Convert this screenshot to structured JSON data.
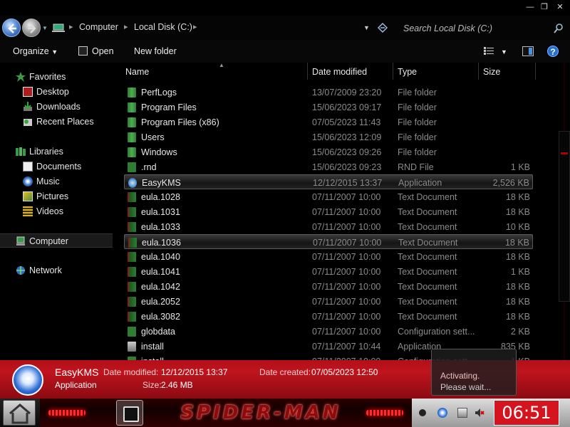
{
  "address": {
    "crumbs": [
      "Computer",
      "Local Disk (C:)"
    ],
    "search_placeholder": "Search Local Disk (C:)"
  },
  "toolbar": {
    "organize": "Organize",
    "open": "Open",
    "new_folder": "New folder"
  },
  "nav": {
    "favorites": "Favorites",
    "desktop": "Desktop",
    "downloads": "Downloads",
    "recent": "Recent Places",
    "libraries": "Libraries",
    "documents": "Documents",
    "music": "Music",
    "pictures": "Pictures",
    "videos": "Videos",
    "computer": "Computer",
    "network": "Network"
  },
  "columns": {
    "name": "Name",
    "date": "Date modified",
    "type": "Type",
    "size": "Size"
  },
  "files": [
    {
      "name": "PerfLogs",
      "date": "13/07/2009 23:20",
      "type": "File folder",
      "size": "",
      "icon": "folder"
    },
    {
      "name": "Program Files",
      "date": "15/06/2023 09:17",
      "type": "File folder",
      "size": "",
      "icon": "folder"
    },
    {
      "name": "Program Files (x86)",
      "date": "07/05/2023 11:43",
      "type": "File folder",
      "size": "",
      "icon": "folder"
    },
    {
      "name": "Users",
      "date": "15/06/2023 12:09",
      "type": "File folder",
      "size": "",
      "icon": "folder"
    },
    {
      "name": "Windows",
      "date": "15/06/2023 09:26",
      "type": "File folder",
      "size": "",
      "icon": "folder"
    },
    {
      "name": ".rnd",
      "date": "15/06/2023 09:23",
      "type": "RND File",
      "size": "1 KB",
      "icon": "rnd"
    },
    {
      "name": "EasyKMS",
      "date": "12/12/2015 13:37",
      "type": "Application",
      "size": "2,526 KB",
      "icon": "app"
    },
    {
      "name": "eula.1028",
      "date": "07/11/2007 10:00",
      "type": "Text Document",
      "size": "18 KB",
      "icon": "doc"
    },
    {
      "name": "eula.1031",
      "date": "07/11/2007 10:00",
      "type": "Text Document",
      "size": "18 KB",
      "icon": "doc"
    },
    {
      "name": "eula.1033",
      "date": "07/11/2007 10:00",
      "type": "Text Document",
      "size": "10 KB",
      "icon": "doc"
    },
    {
      "name": "eula.1036",
      "date": "07/11/2007 10:00",
      "type": "Text Document",
      "size": "18 KB",
      "icon": "doc"
    },
    {
      "name": "eula.1040",
      "date": "07/11/2007 10:00",
      "type": "Text Document",
      "size": "18 KB",
      "icon": "doc"
    },
    {
      "name": "eula.1041",
      "date": "07/11/2007 10:00",
      "type": "Text Document",
      "size": "1 KB",
      "icon": "doc"
    },
    {
      "name": "eula.1042",
      "date": "07/11/2007 10:00",
      "type": "Text Document",
      "size": "18 KB",
      "icon": "doc"
    },
    {
      "name": "eula.2052",
      "date": "07/11/2007 10:00",
      "type": "Text Document",
      "size": "18 KB",
      "icon": "doc"
    },
    {
      "name": "eula.3082",
      "date": "07/11/2007 10:00",
      "type": "Text Document",
      "size": "18 KB",
      "icon": "doc"
    },
    {
      "name": "globdata",
      "date": "07/11/2007 10:00",
      "type": "Configuration sett...",
      "size": "2 KB",
      "icon": "cfg"
    },
    {
      "name": "install",
      "date": "07/11/2007 10:44",
      "type": "Application",
      "size": "835 KB",
      "icon": "inst"
    },
    {
      "name": "install",
      "date": "07/11/2007 10:00",
      "type": "Configuration sett...",
      "size": "1 KB",
      "icon": "cfg"
    }
  ],
  "details": {
    "name": "EasyKMS",
    "type": "Application",
    "modified_label": "Date modified:",
    "modified_value": "12/12/2015 13:37",
    "created_label": "Date created:",
    "created_value": "07/05/2023 12:50",
    "size_label": "Size:",
    "size_value": "2.46 MB"
  },
  "popup": {
    "line1": "Activating.",
    "line2": "Please wait..."
  },
  "taskbar": {
    "banner_text": "SPIDER-MAN",
    "clock": "06:51"
  },
  "colors": {
    "details_bg": "#c0141e",
    "clock_bg": "#d4141e",
    "folder_icon": "#2e7d32"
  }
}
